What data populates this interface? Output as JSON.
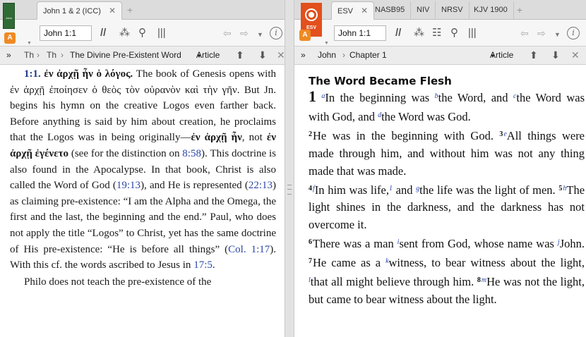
{
  "left_panel": {
    "resource_badge": "A",
    "book_cover_text": "John",
    "tabs": [
      {
        "label": "John 1 & 2 (ICC)",
        "active": true
      }
    ],
    "reference": "John 1:1",
    "breadcrumb": {
      "item1": "Th",
      "item2": "Th",
      "item3": "The Divine Pre-Existent Word",
      "article_label": "Article"
    },
    "text": {
      "p1_ref": "1:1.",
      "p1_greek_title": "ἐν ἀρχῇ ἦν ὁ λόγος.",
      "p1_a": " The book of Genesis opens with ",
      "p1_greek1": "ἐν ἀρχῇ ἐποίησεν ὁ θεὸς τὸν οὐρανὸν καὶ τὴν γῆν",
      "p1_b": ". But Jn. begins his hymn on the creative Logos even farther back. Before anything is said by him about creation, he proclaims that the Logos was in being originally—",
      "p1_greek2": "ἐν ἀρχῇ ἦν",
      "p1_c": ", not ",
      "p1_greek3": "ἐν ἀρχῇ ἐγένετο",
      "p1_d": " (see for the distinction on ",
      "p1_link1": "8:58",
      "p1_e": "). This doctrine is also found in the Apocalypse. In that book, Christ is also called the Word of God (",
      "p1_link2": "19:13",
      "p1_f": "), and He is represented (",
      "p1_link3": "22:13",
      "p1_g": ") as claiming pre-existence: “I am the Alpha and the Omega, the first and the last, the beginning and the end.” Paul, who does not apply the title “Logos” to Christ, yet has the same doctrine of His pre-existence: “He is before all things” (",
      "p1_link4": "Col. 1:17",
      "p1_h": "). With this cf. the words ascribed to Jesus in ",
      "p1_link5": "17:5",
      "p1_i": ".",
      "p2": "Philo does not teach the pre-existence of the"
    }
  },
  "right_panel": {
    "resource_badge": "A",
    "book_cover_text": "ESV",
    "tabs": [
      {
        "label": "ESV",
        "active": true
      },
      {
        "label": "NASB95"
      },
      {
        "label": "NIV"
      },
      {
        "label": "NRSV"
      },
      {
        "label": "KJV 1900"
      }
    ],
    "reference": "John 1:1",
    "breadcrumb": {
      "book": "John",
      "chapter": "Chapter 1",
      "article_label": "Article"
    },
    "heading": "The Word Became Flesh",
    "verses": {
      "chapter": "1",
      "fn_a": "a",
      "v1a": "In the beginning was ",
      "fn_b": "b",
      "v1b": "the Word, and ",
      "fn_c": "c",
      "v1c": "the Word was with God, and ",
      "fn_d": "d",
      "v1d": "the Word was God.",
      "n2": "2",
      "v2": "He was in the beginning with God.",
      "n3": "3",
      "fn_e": "e",
      "v3": "All things were made through him, and without him was not any thing made that was made.",
      "n4": "4",
      "fn_f": "f",
      "v4a": "In him was life,",
      "fn_1": "1",
      "v4b": " and ",
      "fn_g": "g",
      "v4c": "the life was the light of men.",
      "n5": "5",
      "fn_h": "h",
      "v5": "The light shines in the darkness, and the darkness has not overcome it.",
      "n6": "6",
      "v6a": "There was a man ",
      "fn_i": "i",
      "v6b": "sent from God, whose name was ",
      "fn_j": "j",
      "v6c": "John.",
      "n7": "7",
      "v7a": "He came as a ",
      "fn_k": "k",
      "v7b": "witness, to bear witness about the light, ",
      "fn_l": "l",
      "v7c": "that all might believe through him.",
      "n8": "8",
      "fn_m": "m",
      "v8": "He was not the light, but came to bear witness about the light."
    }
  },
  "icons": {
    "parallel": "parallel-resources-icon",
    "visual_filters": "visual-filters-icon",
    "search": "search-icon",
    "columns": "columns-icon",
    "layout": "text-layout-icon",
    "back": "back-arrow-icon",
    "forward": "forward-arrow-icon",
    "info": "info-icon"
  },
  "colors": {
    "link": "#2a46a8",
    "badge": "#ef8a24",
    "esv_cover": "#e2501d",
    "icc_cover": "#2f6b35"
  }
}
